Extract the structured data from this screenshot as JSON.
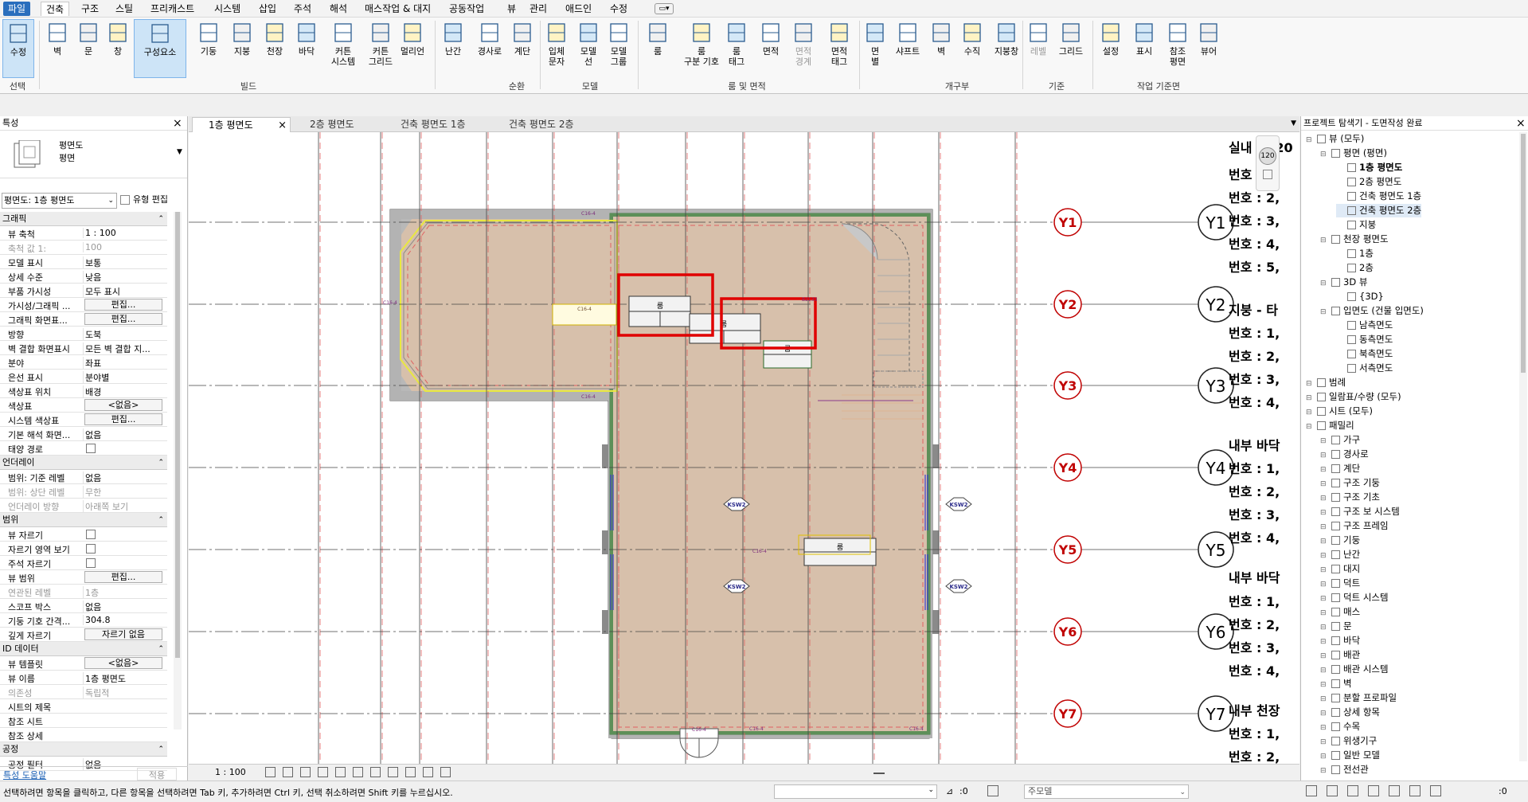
{
  "menubar": {
    "tabs": [
      "파일",
      "건축",
      "구조",
      "스틸",
      "프리캐스트",
      "시스템",
      "삽입",
      "주석",
      "해석",
      "매스작업 & 대지",
      "공동작업",
      "뷰",
      "관리",
      "애드인",
      "수정"
    ]
  },
  "ribbon": {
    "tools": [
      {
        "label": "수정",
        "icon": "cursor-icon"
      },
      {
        "label": "벽",
        "icon": "wall-icon"
      },
      {
        "label": "문",
        "icon": "door-icon"
      },
      {
        "label": "창",
        "icon": "window-icon"
      },
      {
        "label": "구성요소",
        "icon": "component-icon"
      },
      {
        "label": "기둥",
        "icon": "column-icon"
      },
      {
        "label": "지붕",
        "icon": "roof-icon"
      },
      {
        "label": "천장",
        "icon": "ceiling-icon"
      },
      {
        "label": "바닥",
        "icon": "floor-icon"
      },
      {
        "label": "커튼\n시스템",
        "icon": "curtain-system-icon"
      },
      {
        "label": "커튼\n그리드",
        "icon": "curtain-grid-icon"
      },
      {
        "label": "멀리언",
        "icon": "mullion-icon"
      },
      {
        "label": "난간",
        "icon": "railing-icon"
      },
      {
        "label": "경사로",
        "icon": "ramp-icon"
      },
      {
        "label": "계단",
        "icon": "stair-icon"
      },
      {
        "label": "입체\n문자",
        "icon": "model-text-icon"
      },
      {
        "label": "모델\n선",
        "icon": "model-line-icon"
      },
      {
        "label": "모델\n그룹",
        "icon": "model-group-icon"
      },
      {
        "label": "룸",
        "icon": "room-icon"
      },
      {
        "label": "룸\n구분 기호",
        "icon": "room-separator-icon"
      },
      {
        "label": "룸\n태그",
        "icon": "room-tag-icon"
      },
      {
        "label": "면적",
        "icon": "area-icon"
      },
      {
        "label": "면적\n경계",
        "icon": "area-boundary-icon"
      },
      {
        "label": "면적\n태그",
        "icon": "area-tag-icon"
      },
      {
        "label": "면\n별",
        "icon": "by-face-icon"
      },
      {
        "label": "샤프트",
        "icon": "shaft-icon"
      },
      {
        "label": "벽",
        "icon": "wall-opening-icon"
      },
      {
        "label": "수직",
        "icon": "vertical-icon"
      },
      {
        "label": "지붕창",
        "icon": "dormer-icon"
      },
      {
        "label": "레벨",
        "icon": "level-icon"
      },
      {
        "label": "그리드",
        "icon": "grid-icon"
      },
      {
        "label": "설정",
        "icon": "set-icon"
      },
      {
        "label": "표시",
        "icon": "show-icon"
      },
      {
        "label": "참조\n평면",
        "icon": "ref-plane-icon"
      },
      {
        "label": "뷰어",
        "icon": "viewer-icon"
      }
    ],
    "groups": [
      "선택",
      "빌드",
      "순환",
      "모델",
      "룸 및 면적",
      "개구부",
      "기준",
      "작업 기준면"
    ]
  },
  "properties": {
    "title": "특성",
    "type_name": "평면도",
    "type_sub": "평면",
    "view_selector": "평면도: 1층 평면도",
    "edit_type": "유형 편집",
    "sections": {
      "graphics": "그래픽",
      "underlay": "언더레이",
      "extents": "범위",
      "identity": "ID 데이터",
      "phasing": "공정"
    },
    "rows": [
      [
        "뷰 축척",
        "1 : 100"
      ],
      [
        "축척 값   1:",
        "100"
      ],
      [
        "모델 표시",
        "보통"
      ],
      [
        "상세 수준",
        "낮음"
      ],
      [
        "부품 가시성",
        "모두 표시"
      ],
      [
        "가시성/그래픽 ...",
        "편집..."
      ],
      [
        "그래픽 화면표...",
        "편집..."
      ],
      [
        "방향",
        "도북"
      ],
      [
        "벽 결합 화면표시",
        "모든 벽 결합 지..."
      ],
      [
        "분야",
        "좌표"
      ],
      [
        "은선 표시",
        "분야별"
      ],
      [
        "색상표 위치",
        "배경"
      ],
      [
        "색상표",
        "<없음>"
      ],
      [
        "시스템 색상표",
        "편집..."
      ],
      [
        "기본 해석 화면...",
        "없음"
      ],
      [
        "태양 경로",
        ""
      ],
      [
        "범위: 기준 레벨",
        "없음"
      ],
      [
        "범위: 상단 레벨",
        "무한"
      ],
      [
        "언더레이 방향",
        "아래쪽 보기"
      ],
      [
        "뷰 자르기",
        ""
      ],
      [
        "자르기 영역 보기",
        ""
      ],
      [
        "주석 자르기",
        ""
      ],
      [
        "뷰 범위",
        "편집..."
      ],
      [
        "연관된 레벨",
        "1층"
      ],
      [
        "스코프 박스",
        "없음"
      ],
      [
        "기둥 기호 간격...",
        "304.8"
      ],
      [
        "깊게 자르기",
        "자르기 없음"
      ],
      [
        "뷰 템플릿",
        "<없음>"
      ],
      [
        "뷰 이름",
        "1층 평면도"
      ],
      [
        "의존성",
        "독립적"
      ],
      [
        "시트의 제목",
        ""
      ],
      [
        "참조 시트",
        ""
      ],
      [
        "참조 상세",
        ""
      ],
      [
        "공정 필터",
        "없음"
      ]
    ],
    "help": "특성 도움말",
    "apply": "적용"
  },
  "view_tabs": [
    "1층 평면도",
    "2층 평면도",
    "건축 평면도 1층",
    "건축 평면도 2층"
  ],
  "browser": {
    "title": "프로젝트 탐색기 - 도면작성 완료",
    "nodes": [
      {
        "t": "뷰 (모두)",
        "l": 0
      },
      {
        "t": "평면 (평면)",
        "l": 1
      },
      {
        "t": "1층 평면도",
        "l": 2,
        "b": true
      },
      {
        "t": "2층 평면도",
        "l": 2
      },
      {
        "t": "건축 평면도 1층",
        "l": 2
      },
      {
        "t": "건축 평면도 2층",
        "l": 2,
        "s": true
      },
      {
        "t": "지붕",
        "l": 2
      },
      {
        "t": "천장 평면도",
        "l": 1
      },
      {
        "t": "1층",
        "l": 2
      },
      {
        "t": "2층",
        "l": 2
      },
      {
        "t": "3D 뷰",
        "l": 1
      },
      {
        "t": "{3D}",
        "l": 2
      },
      {
        "t": "입면도 (건물 입면도)",
        "l": 1
      },
      {
        "t": "남측면도",
        "l": 2
      },
      {
        "t": "동측면도",
        "l": 2
      },
      {
        "t": "북측면도",
        "l": 2
      },
      {
        "t": "서측면도",
        "l": 2
      },
      {
        "t": "범례",
        "l": 0
      },
      {
        "t": "일람표/수량 (모두)",
        "l": 0
      },
      {
        "t": "시트 (모두)",
        "l": 0
      },
      {
        "t": "패밀리",
        "l": 0
      },
      {
        "t": "가구",
        "l": 1
      },
      {
        "t": "경사로",
        "l": 1
      },
      {
        "t": "계단",
        "l": 1
      },
      {
        "t": "구조 기둥",
        "l": 1
      },
      {
        "t": "구조 기초",
        "l": 1
      },
      {
        "t": "구조 보 시스템",
        "l": 1
      },
      {
        "t": "구조 프레임",
        "l": 1
      },
      {
        "t": "기둥",
        "l": 1
      },
      {
        "t": "난간",
        "l": 1
      },
      {
        "t": "대지",
        "l": 1
      },
      {
        "t": "덕트",
        "l": 1
      },
      {
        "t": "덕트 시스템",
        "l": 1
      },
      {
        "t": "매스",
        "l": 1
      },
      {
        "t": "문",
        "l": 1
      },
      {
        "t": "바닥",
        "l": 1
      },
      {
        "t": "배관",
        "l": 1
      },
      {
        "t": "배관 시스템",
        "l": 1
      },
      {
        "t": "벽",
        "l": 1
      },
      {
        "t": "분할 프로파일",
        "l": 1
      },
      {
        "t": "상세 항목",
        "l": 1
      },
      {
        "t": "수목",
        "l": 1
      },
      {
        "t": "위생기구",
        "l": 1
      },
      {
        "t": "일반 모델",
        "l": 1
      },
      {
        "t": "전선관",
        "l": 1
      }
    ]
  },
  "canvas": {
    "grid_y": [
      "Y1",
      "Y2",
      "Y3",
      "Y4",
      "Y5",
      "Y6",
      "Y7"
    ],
    "schedule": [
      "실내 - 120",
      "번호 : 1,",
      "번호 : 2,",
      "번호 : 3,",
      "번호 : 4,",
      "번호 : 5,",
      "지붕 - 타",
      "번호 : 1,",
      "번호 : 2,",
      "번호 : 3,",
      "번호 : 4,",
      "내부 바닥",
      "번호 : 1,",
      "번호 : 2,",
      "번호 : 3,",
      "번호 : 4,",
      "내부 바닥",
      "번호 : 1,",
      "번호 : 2,",
      "번호 : 3,",
      "번호 : 4,",
      "내부 천장",
      "번호 : 1,",
      "번호 : 2,"
    ],
    "room_label": "룸",
    "small_tags": [
      "C16-4",
      "B2133",
      "C16-4",
      "C16-4",
      "KSW2",
      "KSW2",
      "KSW2",
      "KSW2",
      "C16-4",
      "C16-4",
      "C16-4",
      "C16-4"
    ],
    "level_bubble": "120"
  },
  "viewbar": {
    "scale": "1 : 100"
  },
  "status": {
    "hint": "선택하려면 항목을 클릭하고, 다른 항목을 선택하려면 Tab 키, 추가하려면 Ctrl 키, 선택 취소하려면 Shift 키를 누르십시오.",
    "count1": ":0",
    "model": "주모델",
    "count2": ":0"
  }
}
